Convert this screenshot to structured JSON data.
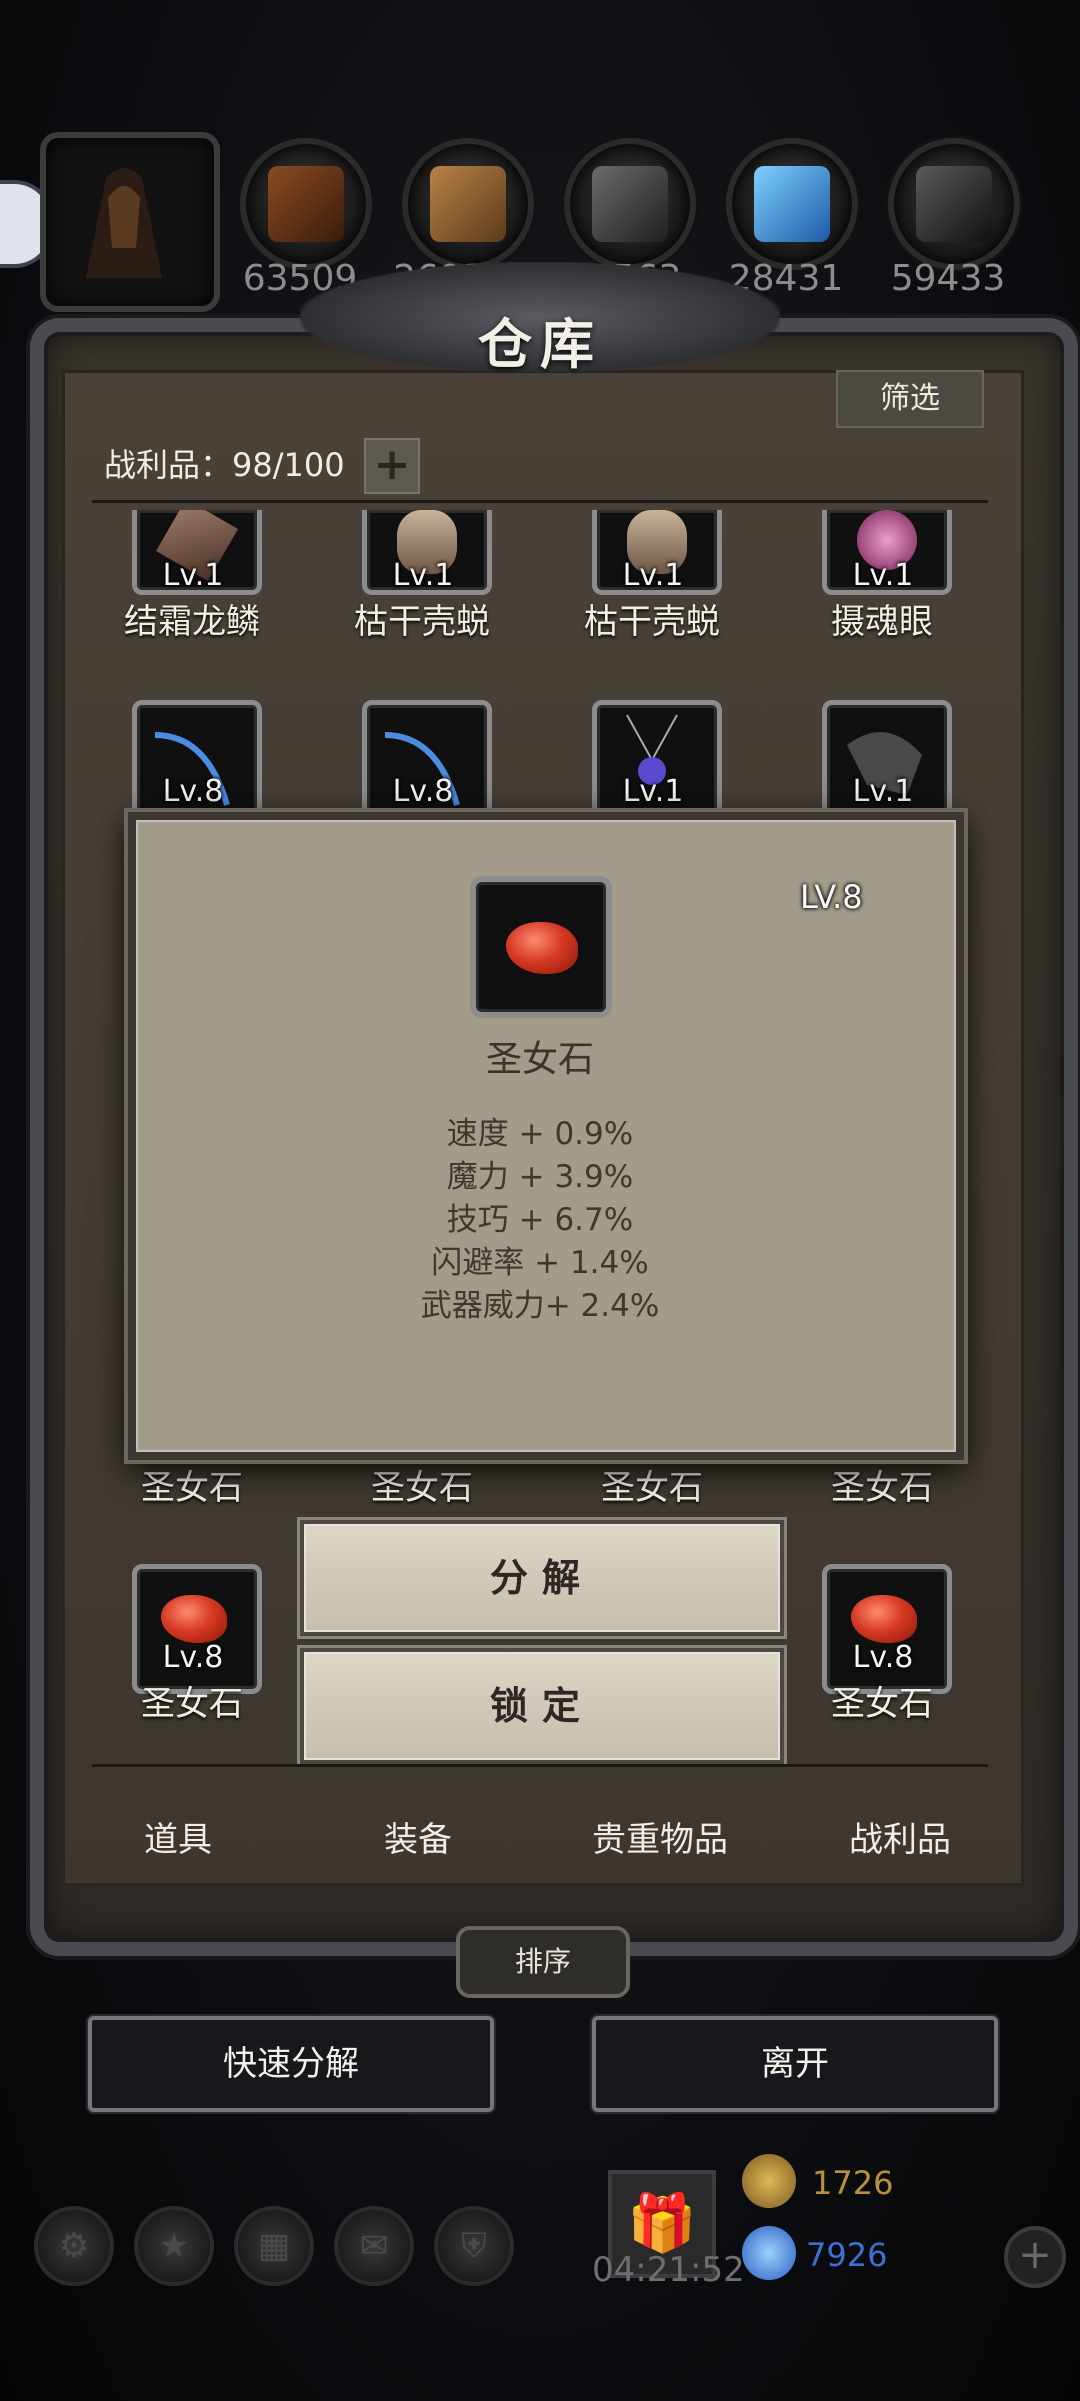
{
  "resources": [
    {
      "icon": "horn-resource-icon",
      "value": "63509"
    },
    {
      "icon": "wood-planks-icon",
      "value": "269375"
    },
    {
      "icon": "iron-ingots-icon",
      "value": "24563"
    },
    {
      "icon": "blue-crystal-icon",
      "value": "28431"
    },
    {
      "icon": "dark-ore-icon",
      "value": "59433"
    }
  ],
  "warehouse": {
    "title": "仓库",
    "filter_label": "筛选",
    "count_label": "战利品：98/100",
    "plus_label": "+"
  },
  "items_row1": [
    {
      "level": "Lv.1",
      "name": "结霜龙鳞"
    },
    {
      "level": "Lv.1",
      "name": "枯干壳蜕"
    },
    {
      "level": "Lv.1",
      "name": "枯干壳蜕"
    },
    {
      "level": "Lv.1",
      "name": "摄魂眼"
    }
  ],
  "items_row2": [
    {
      "level": "Lv.8"
    },
    {
      "level": "Lv.8"
    },
    {
      "level": "Lv.1"
    },
    {
      "level": "Lv.1"
    }
  ],
  "items_row3_names": [
    "圣女石",
    "圣女石",
    "圣女石",
    "圣女石"
  ],
  "items_row4": [
    {
      "level": "Lv.8",
      "name": "圣女石"
    },
    {
      "level": "Lv.8",
      "name": "圣女石"
    }
  ],
  "detail": {
    "level": "LV.8",
    "name": "圣女石",
    "stats": [
      "速度 + 0.9%",
      "魔力 + 3.9%",
      "技巧 + 6.7%",
      "闪避率 + 1.4%",
      "武器威力+ 2.4%"
    ]
  },
  "actions": {
    "decompose": "分解",
    "lock": "锁定"
  },
  "tabs": [
    "道具",
    "装备",
    "贵重物品",
    "战利品"
  ],
  "sort_label": "排序",
  "bottom": {
    "quick_decompose": "快速分解",
    "leave": "离开"
  },
  "footer": {
    "timer": "04:21:52",
    "gold": "1726",
    "gems": "7926",
    "gold_color": "#b8913a",
    "gem_color": "#3d6fd0"
  },
  "colors": {
    "accent_gem": "#d63a24",
    "panel": "#3a342d",
    "popup": "#a49c8a"
  }
}
